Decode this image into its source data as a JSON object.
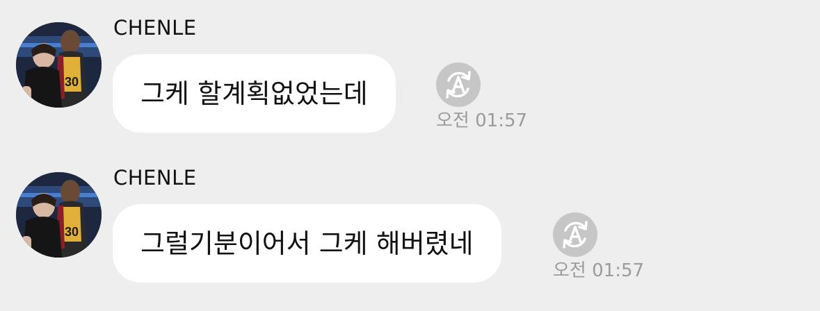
{
  "messages": [
    {
      "sender": "CHENLE",
      "text": "그케 할계획없었는데",
      "time": "오전 01:57",
      "translate_icon": "auto-translate-icon",
      "avatar_icon": "profile-photo"
    },
    {
      "sender": "CHENLE",
      "text": "그럴기분이어서 그케 해버렸네",
      "time": "오전 01:57",
      "translate_icon": "auto-translate-icon",
      "avatar_icon": "profile-photo"
    }
  ],
  "colors": {
    "background": "#eeeeee",
    "bubble": "#ffffff",
    "translate_button": "#c6c6c6",
    "time_text": "#9b9b9b"
  }
}
